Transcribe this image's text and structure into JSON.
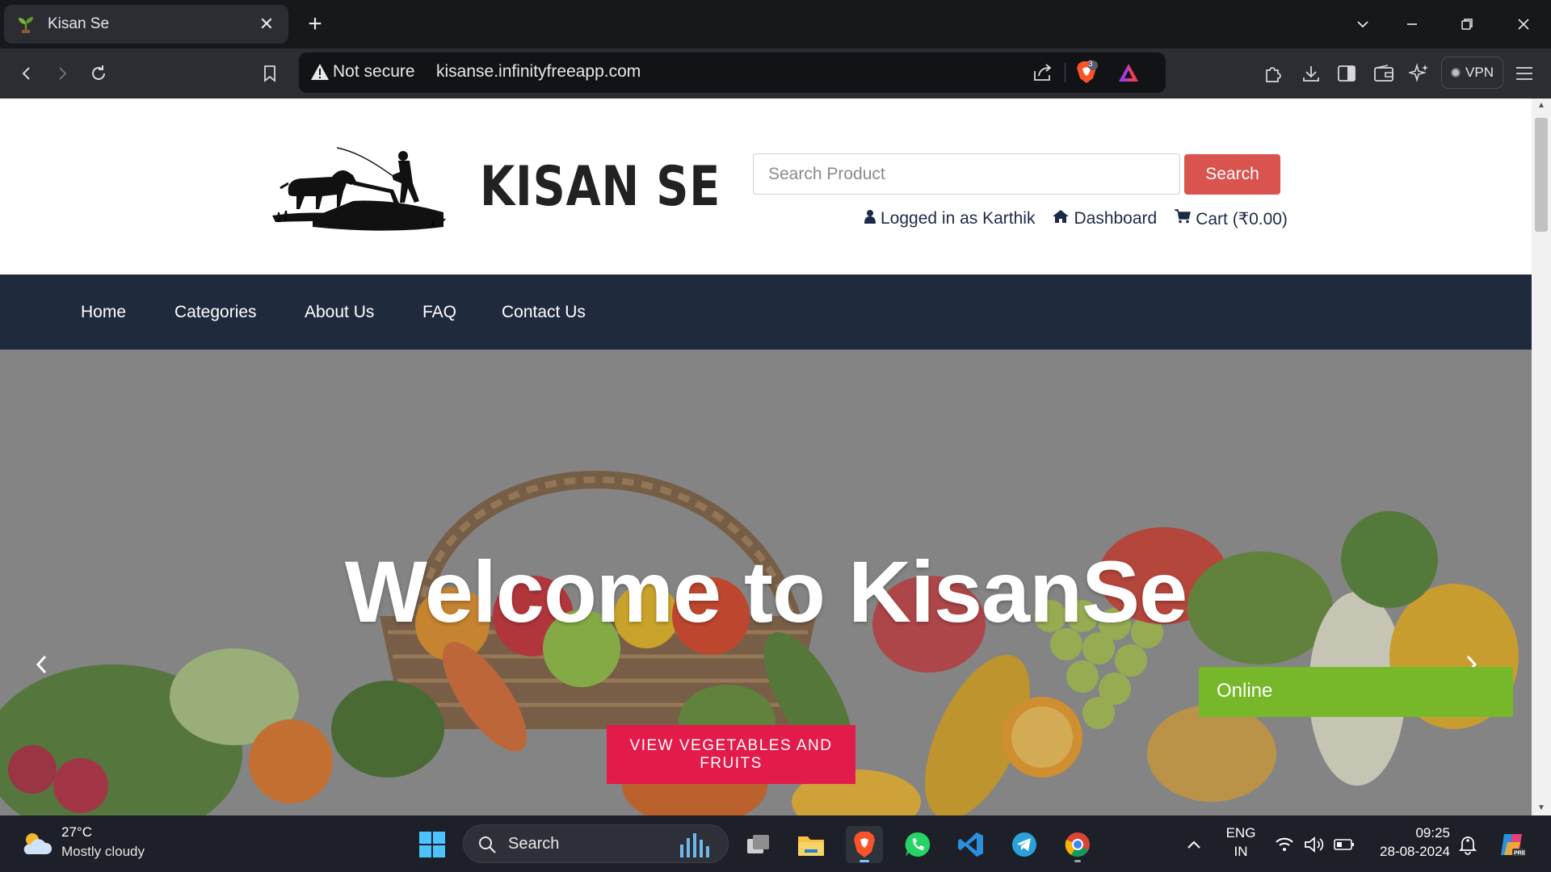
{
  "browser": {
    "tab_title": "Kisan Se",
    "new_tab": "+",
    "security_label": "Not secure",
    "url": "kisanse.infinityfreeapp.com",
    "shields_count": "3",
    "vpn_label": "VPN"
  },
  "site": {
    "brand": "KISAN SE",
    "search_placeholder": "Search Product",
    "search_button": "Search",
    "user_links": {
      "logged_in": "Logged in as Karthik",
      "dashboard": "Dashboard",
      "cart": "Cart (₹0.00)"
    },
    "nav": [
      "Home",
      "Categories",
      "About Us",
      "FAQ",
      "Contact Us"
    ],
    "hero": {
      "title": "Welcome to KisanSe",
      "cta": "VIEW VEGETABLES AND FRUITS"
    },
    "chat_status": "Online"
  },
  "taskbar": {
    "weather_temp": "27°C",
    "weather_condition": "Mostly cloudy",
    "search_label": "Search",
    "lang_line1": "ENG",
    "lang_line2": "IN",
    "time": "09:25",
    "date": "28-08-2024"
  },
  "colors": {
    "accent_red": "#d9534f",
    "nav_bg": "#1f2a3c",
    "cta": "#e21b4b",
    "online": "#76b82a"
  }
}
